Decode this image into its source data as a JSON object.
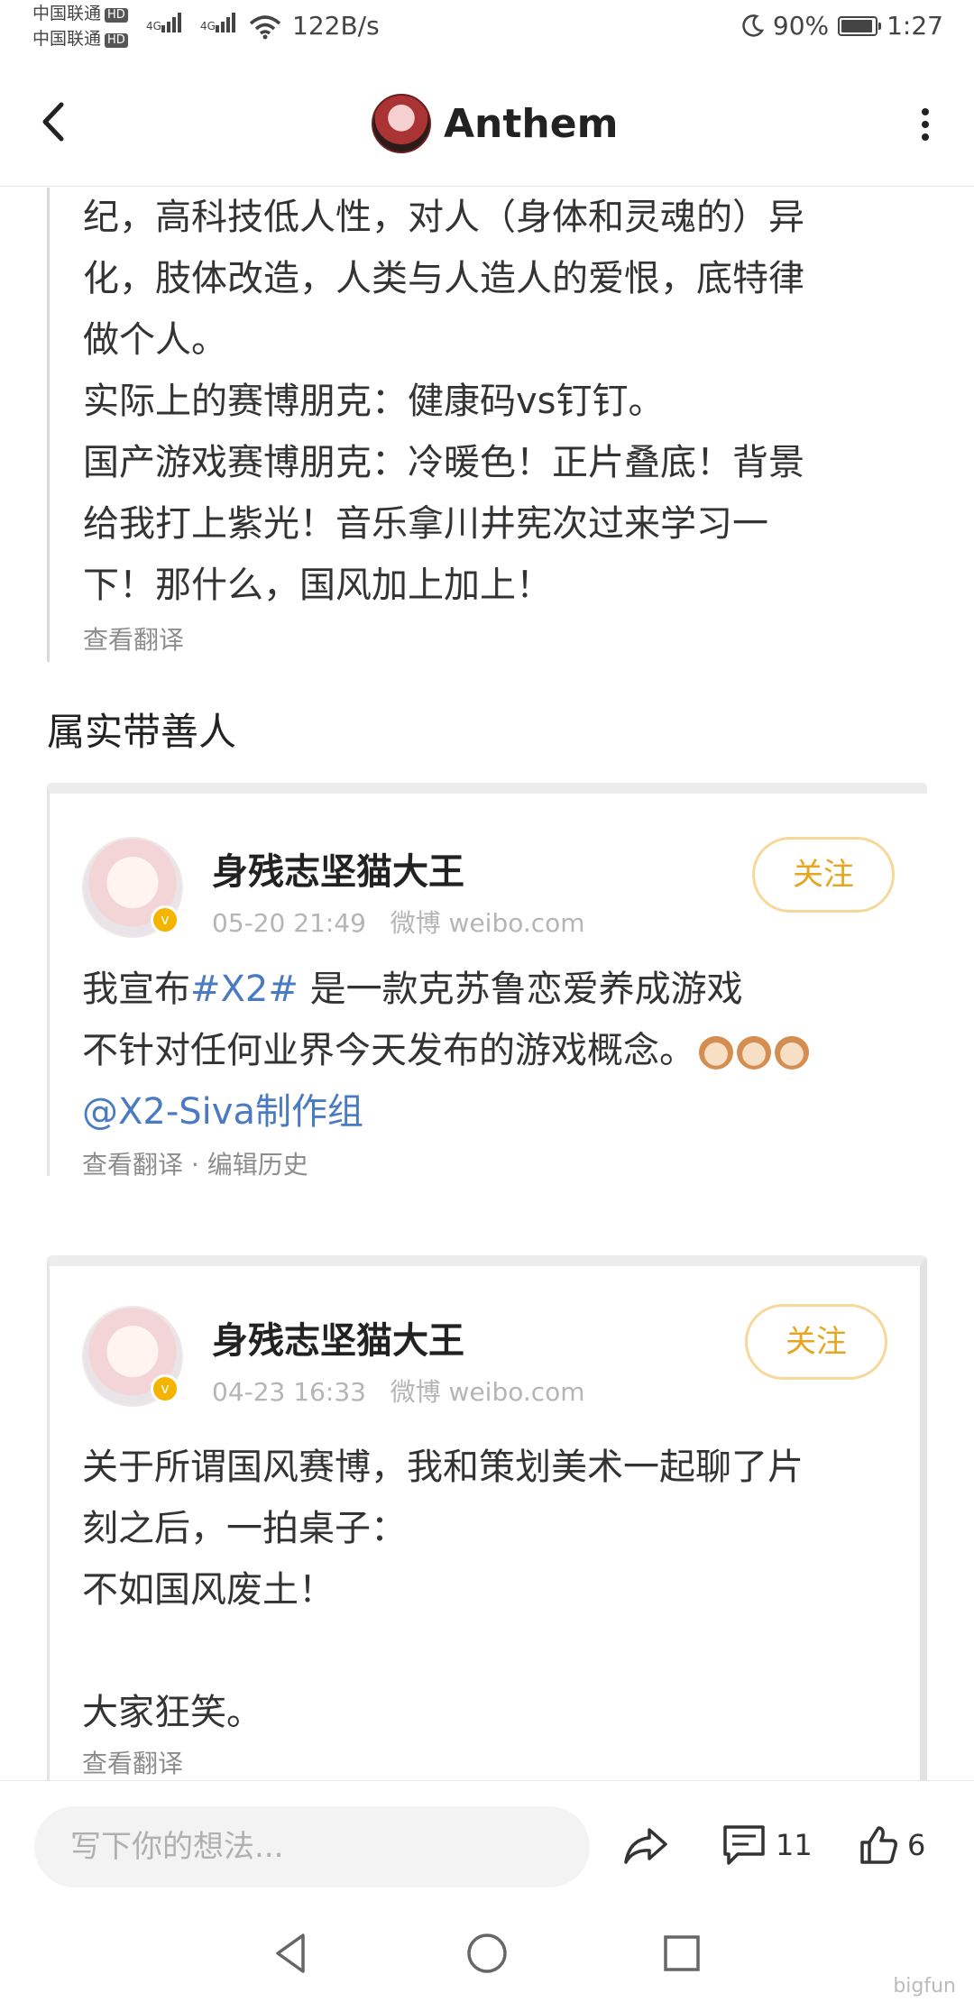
{
  "status_bar": {
    "carrier1": "中国联通",
    "carrier2": "中国联通",
    "hd": "HD",
    "net": "4G",
    "net_speed": "122B/s",
    "battery": "90%",
    "time": "1:27"
  },
  "header": {
    "title": "Anthem"
  },
  "post": {
    "quote_lines": [
      "纪，高科技低人性，对人（身体和灵魂的）异",
      "化，肢体改造，人类与人造人的爱恨，底特律",
      "做个人。",
      "实际上的赛博朋克：健康码vs钉钉。",
      "国产游戏赛博朋克：冷暖色！正片叠底！背景",
      "给我打上紫光！音乐拿川井宪次过来学习一",
      "下！那什么，国风加上加上！"
    ],
    "quote_translate": "查看翻译",
    "comment_text": "属实带善人",
    "cards": [
      {
        "author": "身残志坚猫大王",
        "date": "05-20 21:49",
        "source": "微博 weibo.com",
        "follow": "关注",
        "line1_prefix": "我宣布",
        "line1_hashtag": "#X2#",
        "line1_suffix": " 是一款克苏鲁恋爱养成游戏",
        "line2": "不针对任何业界今天发布的游戏概念。",
        "mention": "@X2-Siva制作组",
        "translate": "查看翻译",
        "dot": "·",
        "edit_history": "编辑历史"
      },
      {
        "author": "身残志坚猫大王",
        "date": "04-23 16:33",
        "source": "微博 weibo.com",
        "follow": "关注",
        "lines": [
          "关于所谓国风赛博，我和策划美术一起聊了片",
          "刻之后，一拍桌子：",
          "不如国风废土！",
          "",
          "大家狂笑。"
        ],
        "translate": "查看翻译"
      }
    ]
  },
  "bottom_bar": {
    "input_placeholder": "写下你的想法...",
    "comment_count": "11",
    "like_count": "6"
  },
  "watermark": "bigfun"
}
